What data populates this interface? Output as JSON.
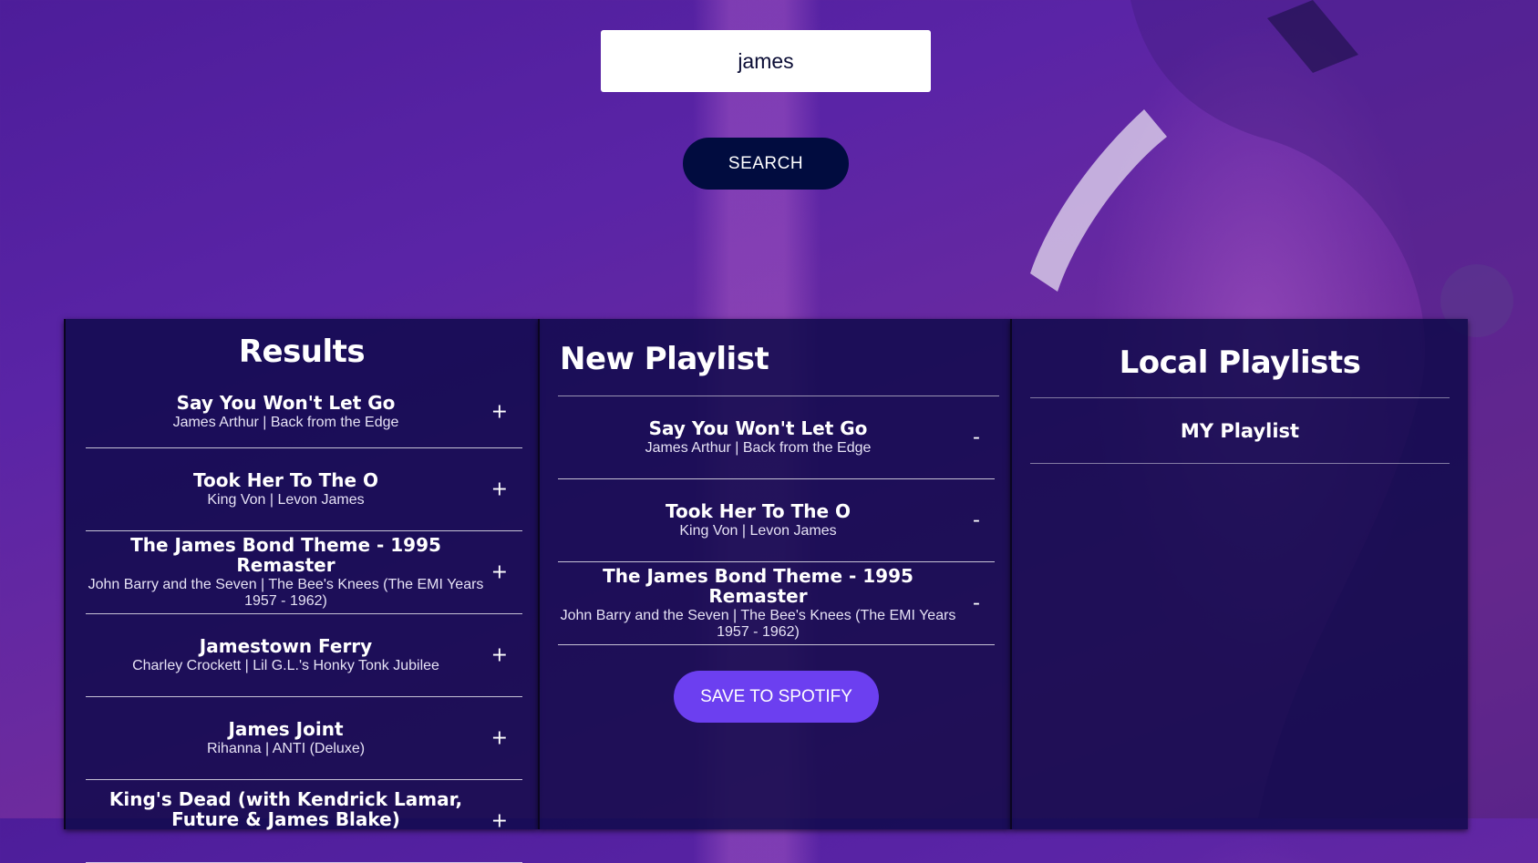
{
  "search": {
    "value": "james",
    "button_label": "SEARCH"
  },
  "results": {
    "title": "Results",
    "tracks": [
      {
        "name": "Say You Won't Let Go",
        "artist_album": "James Arthur | Back from the Edge",
        "action": "+"
      },
      {
        "name": "Took Her To The O",
        "artist_album": "King Von | Levon James",
        "action": "+"
      },
      {
        "name": "The James Bond Theme - 1995 Remaster",
        "artist_album": "John Barry and the Seven | The Bee's Knees (The EMI Years 1957 - 1962)",
        "action": "+"
      },
      {
        "name": "Jamestown Ferry",
        "artist_album": "Charley Crockett | Lil G.L.'s Honky Tonk Jubilee",
        "action": "+"
      },
      {
        "name": "James Joint",
        "artist_album": "Rihanna | ANTI (Deluxe)",
        "action": "+"
      },
      {
        "name": "King's Dead (with Kendrick Lamar, Future & James Blake)",
        "artist_album": "",
        "action": "+"
      }
    ]
  },
  "playlist": {
    "title": "New Playlist",
    "tracks": [
      {
        "name": "Say You Won't Let Go",
        "artist_album": "James Arthur | Back from the Edge",
        "action": "-"
      },
      {
        "name": "Took Her To The O",
        "artist_album": "King Von | Levon James",
        "action": "-"
      },
      {
        "name": "The James Bond Theme - 1995 Remaster",
        "artist_album": "John Barry and the Seven | The Bee's Knees (The EMI Years 1957 - 1962)",
        "action": "-"
      }
    ],
    "save_label": "SAVE TO SPOTIFY"
  },
  "local_playlists": {
    "title": "Local Playlists",
    "items": [
      {
        "name": "MY Playlist"
      }
    ]
  }
}
